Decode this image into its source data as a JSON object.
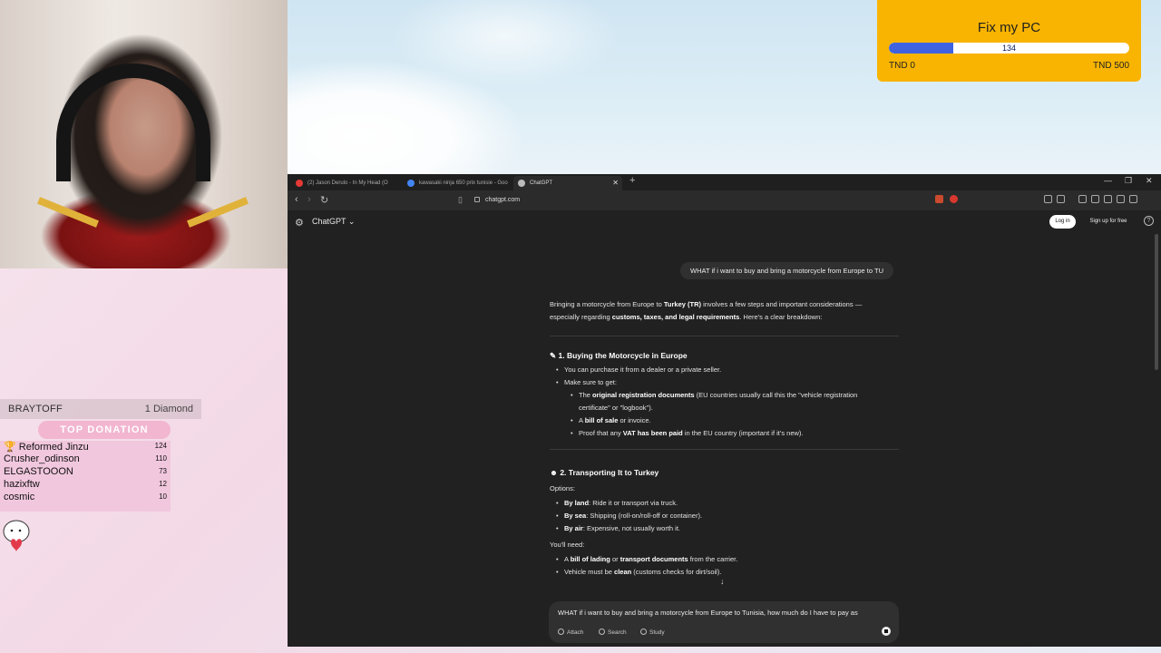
{
  "overlay": {
    "goal": {
      "title": "Fix my PC",
      "current": "134",
      "progress_fraction": 0.268,
      "min_label": "TND 0",
      "max_label": "TND 500",
      "color": "#f8b400"
    },
    "leaderboard": {
      "top_name": "BRAYTOFF",
      "top_count": "1 Diamond",
      "badge_label": "TOP DONATION",
      "rows": [
        {
          "name": "🏆 Reformed Jinzu",
          "value": "124"
        },
        {
          "name": "Crusher_odinson",
          "value": "110"
        },
        {
          "name": "ELGASTOOON",
          "value": "73"
        },
        {
          "name": "hazixftw",
          "value": "12"
        },
        {
          "name": "cosmic",
          "value": "10"
        }
      ]
    }
  },
  "browser": {
    "tabs": [
      {
        "label": "(2) Jason Derulo - In My Head (O",
        "favicon_color": "#e53935"
      },
      {
        "label": "kawasaki ninja 650 prix tunisie - Goo",
        "favicon_color": "#4285f4"
      },
      {
        "label": "ChatGPT",
        "favicon_color": "#bbbbbb"
      }
    ],
    "url": "chatgpt.com"
  },
  "chat": {
    "app_title": "ChatGPT",
    "login_label": "Log in",
    "signup_label": "Sign up for free",
    "user_message": "WHAT if i want to buy and bring a motorcycle from Europe to TU",
    "composer_text": "WHAT if i want to buy and bring a motorcycle from Europe to Tunisia, how much do I have to pay as",
    "composer_buttons": {
      "attach": "Attach",
      "search": "Search",
      "study": "Study"
    },
    "answer": {
      "intro_1": "Bringing a motorcycle from Europe to ",
      "intro_b1": "Turkey (TR)",
      "intro_2": " involves a few steps and important considerations —",
      "intro_3": "especially regarding ",
      "intro_b2": "customs, taxes, and legal requirements",
      "intro_4": ". Here's a clear breakdown:",
      "s1_title": "1. Buying the Motorcycle in Europe",
      "s1_b1": "You can purchase it from a dealer or a private seller.",
      "s1_b2": "Make sure to get:",
      "s1_c1_pre": "The ",
      "s1_c1_b": "original registration documents",
      "s1_c1_post": " (EU countries usually call this the \"vehicle registration",
      "s1_c1_cont": "certificate\" or \"logbook\").",
      "s1_c2_pre": "A ",
      "s1_c2_b": "bill of sale",
      "s1_c2_post": " or invoice.",
      "s1_c3_pre": "Proof that any ",
      "s1_c3_b": "VAT has been paid",
      "s1_c3_post": " in the EU country (important if it's new).",
      "s2_title": "2. Transporting It to Turkey",
      "options_label": "Options:",
      "s2_o1_b": "By land",
      "s2_o1": ": Ride it or transport via truck.",
      "s2_o2_b": "By sea",
      "s2_o2": ": Shipping (roll-on/roll-off or container).",
      "s2_o3_b": "By air",
      "s2_o3": ": Expensive, not usually worth it.",
      "need_label": "You'll need:",
      "s2_n1_pre": "A ",
      "s2_n1_b1": "bill of lading",
      "s2_n1_mid": " or ",
      "s2_n1_b2": "transport documents",
      "s2_n1_post": " from the carrier.",
      "s2_n2_pre": "Vehicle must be ",
      "s2_n2_b": "clean",
      "s2_n2_post": " (customs checks for dirt/soil)."
    }
  }
}
